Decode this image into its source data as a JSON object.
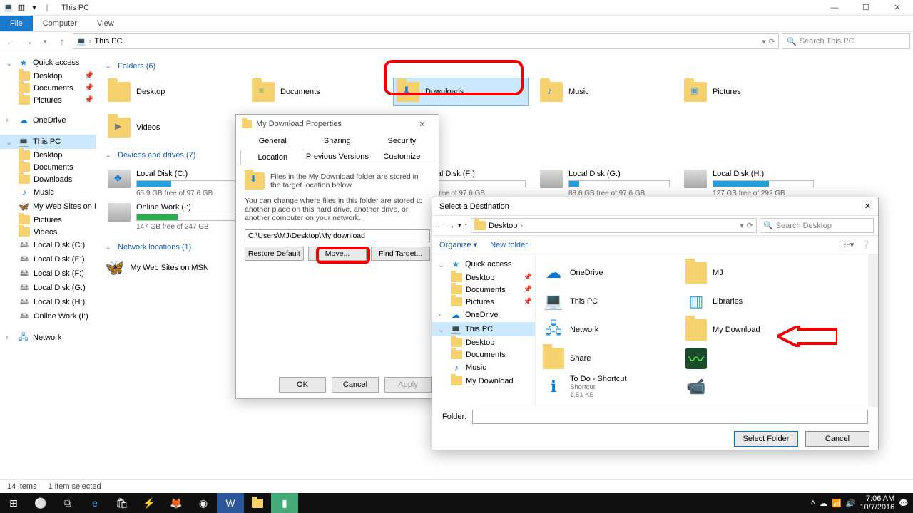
{
  "titlebar": {
    "title": "This PC"
  },
  "menubar": {
    "file": "File",
    "computer": "Computer",
    "view": "View"
  },
  "address": {
    "crumb": "This PC",
    "search_ph": "Search This PC"
  },
  "nav": {
    "quick": "Quick access",
    "quick_items": [
      "Desktop",
      "Documents",
      "Pictures"
    ],
    "onedrive": "OneDrive",
    "thispc": "This PC",
    "pc_items": [
      "Desktop",
      "Documents",
      "Downloads",
      "Music",
      "My Web Sites on M",
      "Pictures",
      "Videos",
      "Local Disk (C:)",
      "Local Disk (E:)",
      "Local Disk (F:)",
      "Local Disk (G:)",
      "Local Disk (H:)",
      "Online Work (I:)"
    ],
    "network": "Network"
  },
  "groups": {
    "folders": "Folders (6)",
    "folder_items": [
      "Desktop",
      "Documents",
      "Downloads",
      "Music",
      "Pictures",
      "Videos"
    ],
    "drives": "Devices and drives (7)",
    "drive_items": [
      {
        "name": "Local Disk (C:)",
        "free": "65.9 GB free of 97.6 GB",
        "pct": 34
      },
      {
        "name": "Online Work (I:)",
        "free": "147 GB free of 247 GB",
        "pct": 41
      },
      {
        "name": "Local Disk (F:)",
        "free": "GB free of 97.6 GB",
        "pct": 12
      },
      {
        "name": "Local Disk (G:)",
        "free": "88.6 GB free of 97.6 GB",
        "pct": 10
      },
      {
        "name": "Local Disk (H:)",
        "free": "127 GB free of 292 GB",
        "pct": 56
      }
    ],
    "netloc": "Network locations (1)",
    "netloc_item": "My Web Sites on MSN"
  },
  "status": {
    "count": "14 items",
    "sel": "1 item selected"
  },
  "clock": {
    "time": "7:06 AM",
    "date": "10/7/2016"
  },
  "props": {
    "title": "My Download Properties",
    "tabs": [
      "General",
      "Sharing",
      "Security",
      "Location",
      "Previous Versions",
      "Customize"
    ],
    "line1": "Files in the My Download folder are stored in the target location below.",
    "line2": "You can change where files in this folder are stored to another place on this hard drive, another drive, or another computer on your network.",
    "path": "C:\\Users\\MJ\\Desktop\\My download",
    "restore": "Restore Default",
    "move": "Move...",
    "find": "Find Target...",
    "ok": "OK",
    "cancel": "Cancel",
    "apply": "Apply"
  },
  "dest": {
    "title": "Select a Destination",
    "crumb": "Desktop",
    "search_ph": "Search Desktop",
    "organize": "Organize ▾",
    "newfolder": "New folder",
    "nav": {
      "quick": "Quick access",
      "quick_items": [
        "Desktop",
        "Documents",
        "Pictures"
      ],
      "onedrive": "OneDrive",
      "thispc": "This PC",
      "pc_items": [
        "Desktop",
        "Documents",
        "Music",
        "My Download"
      ]
    },
    "items": [
      {
        "label": "OneDrive",
        "icon": "cloud"
      },
      {
        "label": "MJ",
        "icon": "user"
      },
      {
        "label": "This PC",
        "icon": "pc"
      },
      {
        "label": "Libraries",
        "icon": "lib"
      },
      {
        "label": "Network",
        "icon": "net"
      },
      {
        "label": "My Download",
        "icon": "folder"
      },
      {
        "label": "Share",
        "icon": "folder"
      },
      {
        "label": "",
        "icon": "app"
      },
      {
        "label": "To Do - Shortcut",
        "sub": "Shortcut",
        "sub2": "1.51 KB",
        "icon": "info"
      },
      {
        "label": "",
        "icon": "cam"
      }
    ],
    "folder_lbl": "Folder:",
    "select": "Select Folder",
    "cancel": "Cancel"
  }
}
